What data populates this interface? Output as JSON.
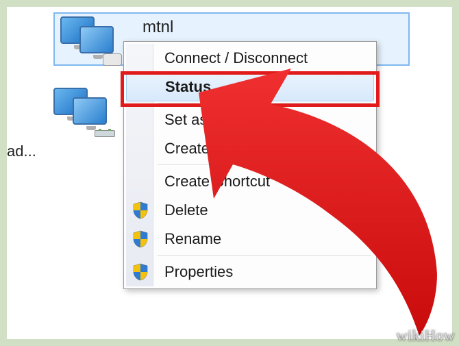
{
  "selected_connection": {
    "name": "mtnl",
    "icon": "dialup-connection-icon"
  },
  "other_connection": {
    "icon": "lan-connection-icon"
  },
  "orphan_label": "ad...",
  "context_menu": {
    "items": [
      {
        "label": "Connect / Disconnect",
        "icon": null,
        "highlight": false
      },
      {
        "label": "Status",
        "icon": null,
        "highlight": true
      },
      {
        "sep": true
      },
      {
        "label": "Set as Default",
        "icon": null,
        "highlight": false
      },
      {
        "label": "Create Copy",
        "icon": null,
        "highlight": false
      },
      {
        "sep": true
      },
      {
        "label": "Create Shortcut",
        "icon": null,
        "highlight": false
      },
      {
        "label": "Delete",
        "icon": "uac-shield-icon",
        "highlight": false
      },
      {
        "label": "Rename",
        "icon": "uac-shield-icon",
        "highlight": false
      },
      {
        "sep": true
      },
      {
        "label": "Properties",
        "icon": "uac-shield-icon",
        "highlight": false
      }
    ]
  },
  "annotation": {
    "highlight_box_color": "#e11b1b",
    "arrow_color": "#ed1c24"
  },
  "watermark": "wikiHow"
}
